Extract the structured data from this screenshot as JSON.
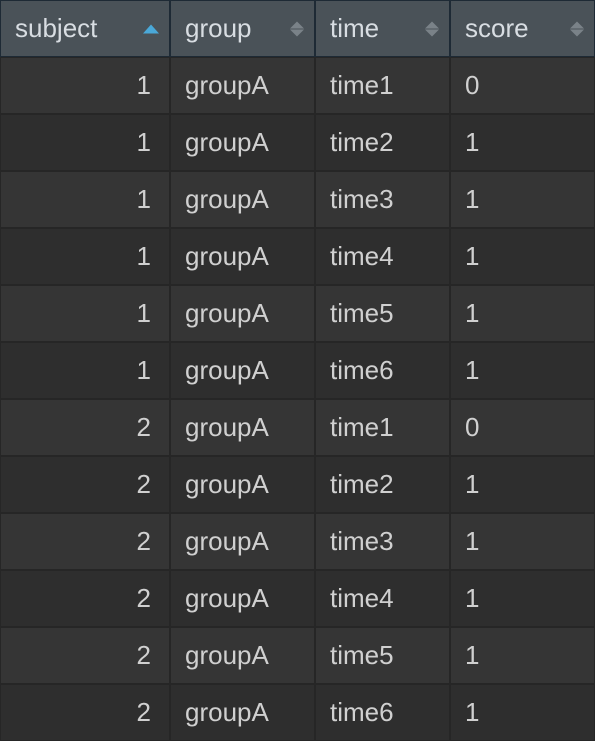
{
  "columns": [
    {
      "label": "subject",
      "sorted": "asc"
    },
    {
      "label": "group",
      "sorted": "none"
    },
    {
      "label": "time",
      "sorted": "none"
    },
    {
      "label": "score",
      "sorted": "none"
    }
  ],
  "rows": [
    {
      "subject": "1",
      "group": "groupA",
      "time": "time1",
      "score": "0"
    },
    {
      "subject": "1",
      "group": "groupA",
      "time": "time2",
      "score": "1"
    },
    {
      "subject": "1",
      "group": "groupA",
      "time": "time3",
      "score": "1"
    },
    {
      "subject": "1",
      "group": "groupA",
      "time": "time4",
      "score": "1"
    },
    {
      "subject": "1",
      "group": "groupA",
      "time": "time5",
      "score": "1"
    },
    {
      "subject": "1",
      "group": "groupA",
      "time": "time6",
      "score": "1"
    },
    {
      "subject": "2",
      "group": "groupA",
      "time": "time1",
      "score": "0"
    },
    {
      "subject": "2",
      "group": "groupA",
      "time": "time2",
      "score": "1"
    },
    {
      "subject": "2",
      "group": "groupA",
      "time": "time3",
      "score": "1"
    },
    {
      "subject": "2",
      "group": "groupA",
      "time": "time4",
      "score": "1"
    },
    {
      "subject": "2",
      "group": "groupA",
      "time": "time5",
      "score": "1"
    },
    {
      "subject": "2",
      "group": "groupA",
      "time": "time6",
      "score": "1"
    }
  ]
}
